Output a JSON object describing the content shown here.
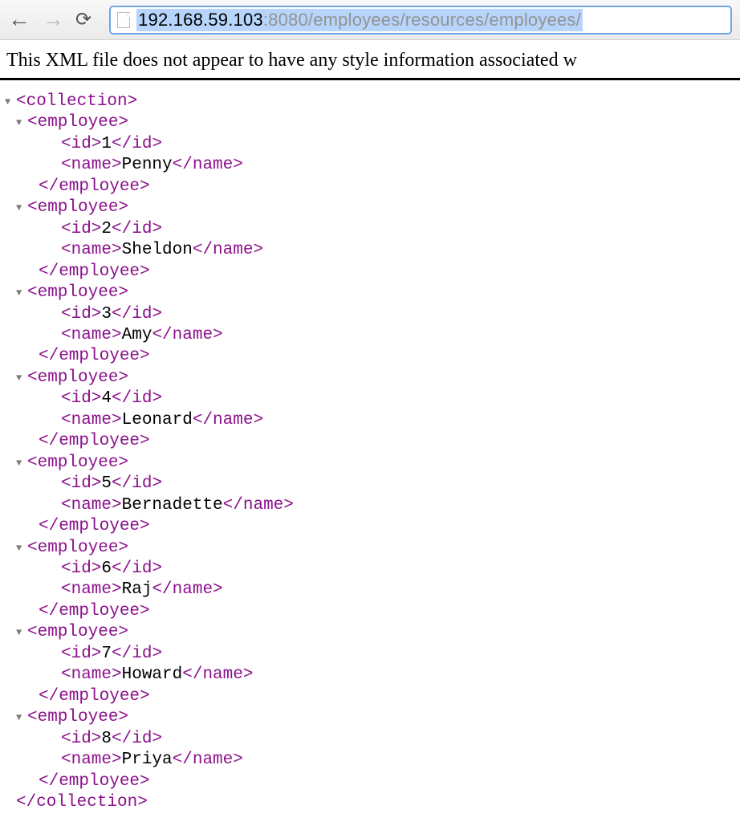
{
  "url": {
    "host": "192.168.59.103",
    "port_path": ":8080/employees/resources/employees/"
  },
  "message": "This XML file does not appear to have any style information associated w",
  "xml": {
    "root": "collection",
    "item_tag": "employee",
    "field_id": "id",
    "field_name": "name",
    "employees": [
      {
        "id": "1",
        "name": "Penny"
      },
      {
        "id": "2",
        "name": "Sheldon"
      },
      {
        "id": "3",
        "name": "Amy"
      },
      {
        "id": "4",
        "name": "Leonard"
      },
      {
        "id": "5",
        "name": "Bernadette"
      },
      {
        "id": "6",
        "name": "Raj"
      },
      {
        "id": "7",
        "name": "Howard"
      },
      {
        "id": "8",
        "name": "Priya"
      }
    ]
  }
}
